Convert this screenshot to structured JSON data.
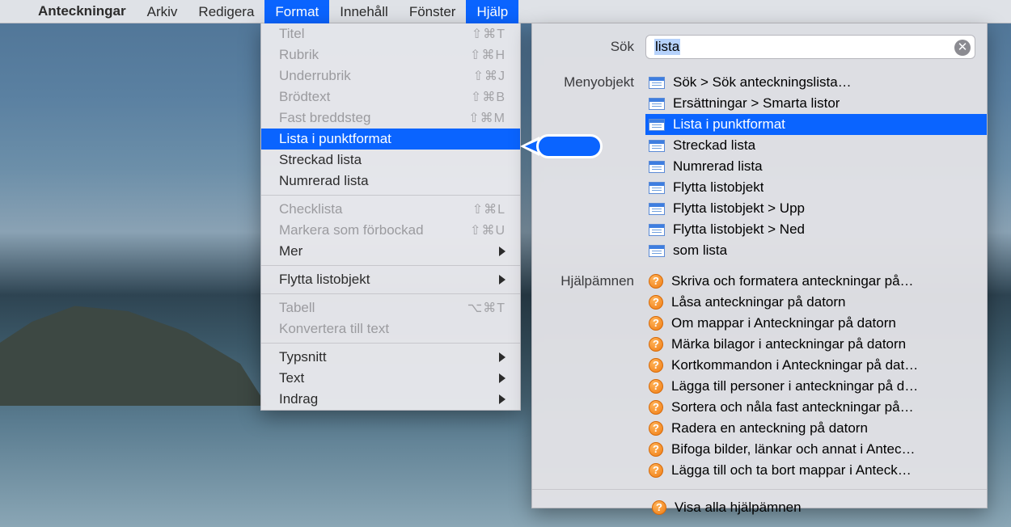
{
  "menubar": {
    "app": "Anteckningar",
    "items": [
      "Arkiv",
      "Redigera",
      "Format",
      "Innehåll",
      "Fönster",
      "Hjälp"
    ],
    "active": [
      "Format",
      "Hjälp"
    ]
  },
  "format_menu": {
    "rows": [
      {
        "label": "Titel",
        "shortcut": "⇧⌘T",
        "disabled": true
      },
      {
        "label": "Rubrik",
        "shortcut": "⇧⌘H",
        "disabled": true
      },
      {
        "label": "Underrubrik",
        "shortcut": "⇧⌘J",
        "disabled": true
      },
      {
        "label": "Brödtext",
        "shortcut": "⇧⌘B",
        "disabled": true
      },
      {
        "label": "Fast breddsteg",
        "shortcut": "⇧⌘M",
        "disabled": true
      },
      {
        "label": "Lista i punktformat",
        "shortcut": "",
        "disabled": false,
        "highlight": true
      },
      {
        "label": "Streckad lista",
        "shortcut": "",
        "disabled": false
      },
      {
        "label": "Numrerad lista",
        "shortcut": "",
        "disabled": false
      },
      {
        "sep": true
      },
      {
        "label": "Checklista",
        "shortcut": "⇧⌘L",
        "disabled": true
      },
      {
        "label": "Markera som förbockad",
        "shortcut": "⇧⌘U",
        "disabled": true
      },
      {
        "label": "Mer",
        "submenu": true,
        "disabled": false
      },
      {
        "sep": true
      },
      {
        "label": "Flytta listobjekt",
        "submenu": true,
        "disabled": false
      },
      {
        "sep": true
      },
      {
        "label": "Tabell",
        "shortcut": "⌥⌘T",
        "disabled": true
      },
      {
        "label": "Konvertera till text",
        "shortcut": "",
        "disabled": true
      },
      {
        "sep": true
      },
      {
        "label": "Typsnitt",
        "submenu": true,
        "disabled": false
      },
      {
        "label": "Text",
        "submenu": true,
        "disabled": false
      },
      {
        "label": "Indrag",
        "submenu": true,
        "disabled": false
      }
    ]
  },
  "help_panel": {
    "search_label": "Sök",
    "search_value": "lista",
    "section_menu_label": "Menyobjekt",
    "menu_items": [
      {
        "label": "Sök > Sök anteckningslista…"
      },
      {
        "label": "Ersättningar > Smarta listor"
      },
      {
        "label": "Lista i punktformat",
        "highlight": true
      },
      {
        "label": "Streckad lista"
      },
      {
        "label": "Numrerad lista"
      },
      {
        "label": "Flytta listobjekt"
      },
      {
        "label": "Flytta listobjekt > Upp"
      },
      {
        "label": "Flytta listobjekt > Ned"
      },
      {
        "label": "som lista"
      }
    ],
    "section_topics_label": "Hjälpämnen",
    "help_topics": [
      "Skriva och formatera anteckningar på…",
      "Låsa anteckningar på datorn",
      "Om mappar i Anteckningar på datorn",
      "Märka bilagor i anteckningar på datorn",
      "Kortkommandon i Anteckningar på dat…",
      "Lägga till personer i anteckningar på d…",
      "Sortera och nåla fast anteckningar på…",
      "Radera en anteckning på datorn",
      "Bifoga bilder, länkar och annat i Antec…",
      "Lägga till och ta bort mappar i Anteck…"
    ],
    "view_all": "Visa alla hjälpämnen"
  }
}
